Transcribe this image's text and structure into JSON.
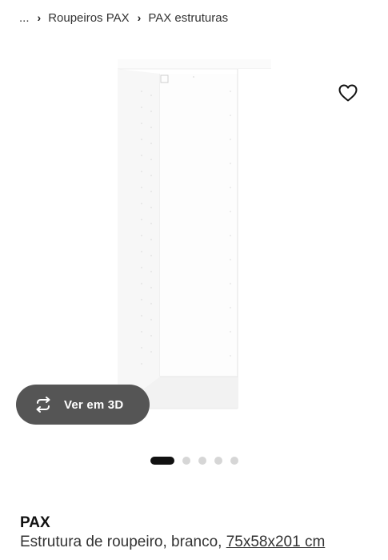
{
  "breadcrumb": {
    "ellipsis": "...",
    "separator": "›",
    "items": [
      {
        "label": "Roupeiros PAX"
      },
      {
        "label": "PAX estruturas"
      }
    ]
  },
  "media": {
    "favorite_icon": "heart-outline-icon",
    "view3d": {
      "label": "Ver em 3D",
      "icon": "rotate-arrows-icon"
    },
    "carousel": {
      "total": 5,
      "active": 1
    }
  },
  "product": {
    "name": "PAX",
    "description": "Estrutura de roupeiro, branco, ",
    "size": "75x58x201 cm"
  },
  "colors": {
    "view3d_bg": "#555555",
    "dot_active": "#111111",
    "dot_inactive": "#d6d6d6"
  }
}
